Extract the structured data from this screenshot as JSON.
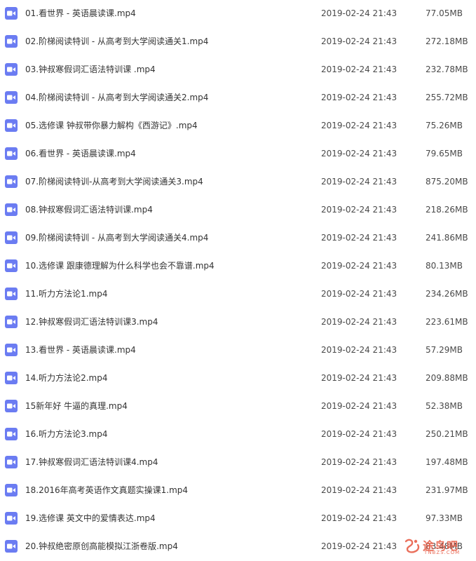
{
  "colors": {
    "icon_bg": "#6b7cf2",
    "icon_glyph": "#ffffff",
    "text": "#333333",
    "meta_text": "#4a4a4a",
    "watermark": "#e8604a"
  },
  "icons": {
    "file": "video-file-icon",
    "watermark": "tubaba-logo-icon"
  },
  "files": [
    {
      "name": "01.看世界 - 英语晨读课.mp4",
      "modified": "2019-02-24 21:43",
      "size": "77.05MB"
    },
    {
      "name": "02.阶梯阅读特训 - 从高考到大学阅读通关1.mp4",
      "modified": "2019-02-24 21:43",
      "size": "272.18MB"
    },
    {
      "name": "03.钟叔寒假词汇语法特训课 .mp4",
      "modified": "2019-02-24 21:43",
      "size": "232.78MB"
    },
    {
      "name": "04.阶梯阅读特训 - 从高考到大学阅读通关2.mp4",
      "modified": "2019-02-24 21:43",
      "size": "255.72MB"
    },
    {
      "name": "05.选修课 钟叔带你暴力解构《西游记》.mp4",
      "modified": "2019-02-24 21:43",
      "size": "75.26MB"
    },
    {
      "name": "06.看世界 - 英语晨读课.mp4",
      "modified": "2019-02-24 21:43",
      "size": "79.65MB"
    },
    {
      "name": "07.阶梯阅读特训-从高考到大学阅读通关3.mp4",
      "modified": "2019-02-24 21:43",
      "size": "875.20MB"
    },
    {
      "name": "08.钟叔寒假词汇语法特训课.mp4",
      "modified": "2019-02-24 21:43",
      "size": "218.26MB"
    },
    {
      "name": "09.阶梯阅读特训 - 从高考到大学阅读通关4.mp4",
      "modified": "2019-02-24 21:43",
      "size": "241.86MB"
    },
    {
      "name": "10.选修课 跟康德理解为什么科学也会不靠谱.mp4",
      "modified": "2019-02-24 21:43",
      "size": "80.13MB"
    },
    {
      "name": "11.听力方法论1.mp4",
      "modified": "2019-02-24 21:43",
      "size": "234.26MB"
    },
    {
      "name": "12.钟叔寒假词汇语法特训课3.mp4",
      "modified": "2019-02-24 21:43",
      "size": "223.61MB"
    },
    {
      "name": "13.看世界 - 英语晨读课.mp4",
      "modified": "2019-02-24 21:43",
      "size": "57.29MB"
    },
    {
      "name": "14.听力方法论2.mp4",
      "modified": "2019-02-24 21:43",
      "size": "209.88MB"
    },
    {
      "name": "15新年好 牛逼的真理.mp4",
      "modified": "2019-02-24 21:43",
      "size": "52.38MB"
    },
    {
      "name": "16.听力方法论3.mp4",
      "modified": "2019-02-24 21:43",
      "size": "250.21MB"
    },
    {
      "name": "17.钟叔寒假词汇语法特训课4.mp4",
      "modified": "2019-02-24 21:43",
      "size": "197.48MB"
    },
    {
      "name": "18.2016年高考英语作文真题实操课1.mp4",
      "modified": "2019-02-24 21:43",
      "size": "231.97MB"
    },
    {
      "name": "19.选修课 英文中的爱情表达.mp4",
      "modified": "2019-02-24 21:43",
      "size": "97.33MB"
    },
    {
      "name": "20.钟叔绝密原创高能模拟江浙卷版.mp4",
      "modified": "2019-02-24 21:43",
      "size": "83.48MB"
    }
  ],
  "watermark": {
    "text": "途鸟吧",
    "subtext": "TNBZS.COM"
  }
}
